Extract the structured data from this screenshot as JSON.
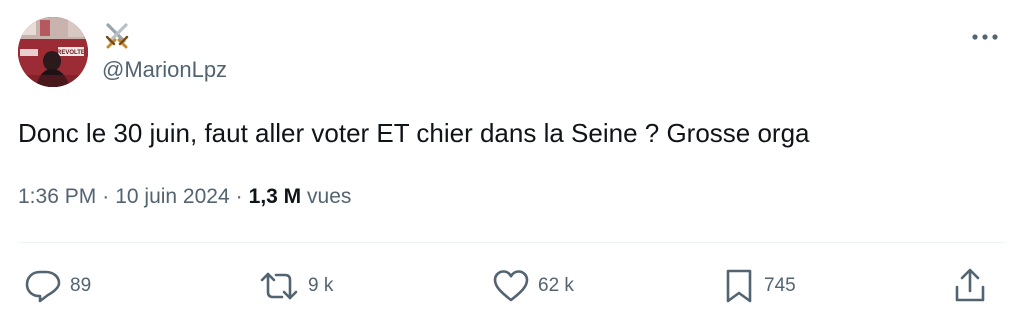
{
  "author": {
    "display_name_icon": "crossed-swords-emoji",
    "display_name": "⚔️",
    "handle": "@MarionLpz",
    "avatar_text": "REVOLTE"
  },
  "tweet": {
    "text": "Donc le 30 juin, faut aller voter ET chier dans la Seine ? Grosse orga",
    "time": "1:36 PM",
    "dot": "·",
    "date": "10 juin 2024",
    "views_count": "1,3 M",
    "views_label": "vues"
  },
  "actions": {
    "replies": "89",
    "reposts": "9 k",
    "likes": "62 k",
    "bookmarks": "745"
  },
  "colors": {
    "text": "#0f1419",
    "secondary": "#536471",
    "divider": "#eff3f4"
  }
}
